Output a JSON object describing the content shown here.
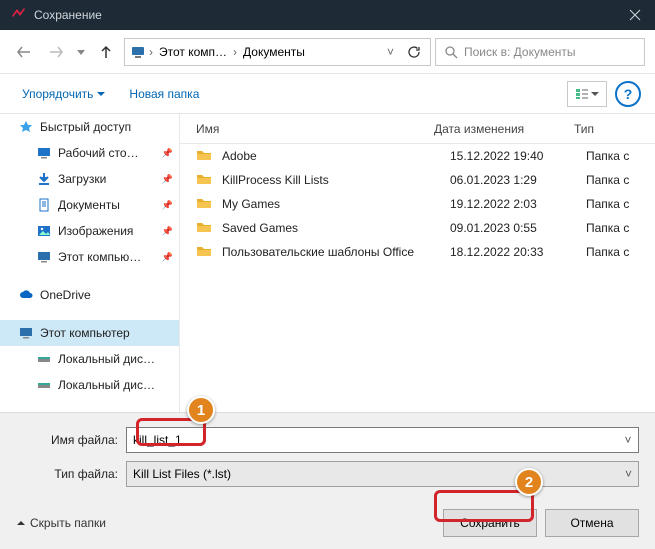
{
  "window": {
    "title": "Сохранение"
  },
  "nav": {
    "breadcrumb": [
      "Этот комп…",
      "Документы"
    ],
    "refresh": "⟳",
    "search_placeholder": "Поиск в: Документы"
  },
  "toolbar": {
    "organize": "Упорядочить",
    "newfolder": "Новая папка"
  },
  "sidebar": {
    "quickaccess": "Быстрый доступ",
    "items": [
      {
        "label": "Рабочий сто…"
      },
      {
        "label": "Загрузки"
      },
      {
        "label": "Документы"
      },
      {
        "label": "Изображения"
      },
      {
        "label": "Этот компью…"
      }
    ],
    "onedrive": "OneDrive",
    "thispc": "Этот компьютер",
    "drives": [
      {
        "label": "Локальный дис…"
      },
      {
        "label": "Локальный дис…"
      }
    ]
  },
  "columns": {
    "name": "Имя",
    "date": "Дата изменения",
    "type": "Тип"
  },
  "files": [
    {
      "name": "Adobe",
      "date": "15.12.2022 19:40",
      "type": "Папка с"
    },
    {
      "name": "KillProcess Kill Lists",
      "date": "06.01.2023 1:29",
      "type": "Папка с"
    },
    {
      "name": "My Games",
      "date": "19.12.2022 2:03",
      "type": "Папка с"
    },
    {
      "name": "Saved Games",
      "date": "09.01.2023 0:55",
      "type": "Папка с"
    },
    {
      "name": "Пользовательские шаблоны Office",
      "date": "18.12.2022 20:33",
      "type": "Папка с"
    }
  ],
  "form": {
    "filename_label": "Имя файла:",
    "filename_value": "kill_list_1",
    "filetype_label": "Тип файла:",
    "filetype_value": "Kill List Files (*.lst)"
  },
  "footer": {
    "hide_folders": "Скрыть папки",
    "save": "Сохранить",
    "cancel": "Отмена"
  },
  "callouts": {
    "one": "1",
    "two": "2"
  }
}
